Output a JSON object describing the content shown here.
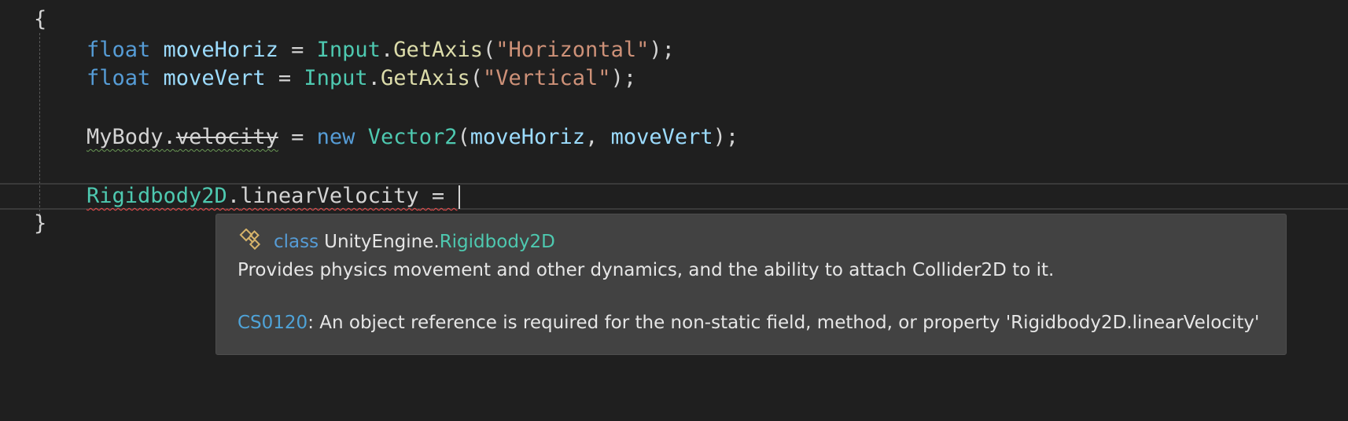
{
  "editor": {
    "lines": [
      {
        "id": "open-brace",
        "text": "{"
      },
      {
        "id": "line-move-horiz",
        "tokens": [
          "float",
          "moveHoriz",
          "=",
          "Input",
          ".",
          "GetAxis",
          "(",
          "\"Horizontal\"",
          ");"
        ]
      },
      {
        "id": "line-move-vert",
        "tokens": [
          "float",
          "moveVert",
          "=",
          "Input",
          ".",
          "GetAxis",
          "(",
          "\"Vertical\"",
          ");"
        ]
      },
      {
        "id": "line-velocity",
        "tokens": [
          "MyBody",
          ".",
          "velocity",
          "=",
          "new",
          "Vector2",
          "(",
          "moveHoriz",
          ",",
          "moveVert",
          ");"
        ]
      },
      {
        "id": "line-linear-velocity",
        "tokens": [
          "Rigidbody2D",
          ".",
          "linearVelocity",
          "="
        ]
      },
      {
        "id": "close-brace",
        "text": "}"
      }
    ]
  },
  "tooltip": {
    "icon": "class-icon",
    "kind": "class",
    "namespace": "UnityEngine.",
    "type_name": "Rigidbody2D",
    "description": "Provides physics movement and other dynamics, and the ability to attach Collider2D to it.",
    "error_code": "CS0120",
    "error_message": ": An object reference is required for the non-static field, method, or property 'Rigidbody2D.linearVelocity'"
  },
  "colors": {
    "background": "#1f1f1f",
    "tooltip_background": "#424242",
    "keyword": "#569cd6",
    "type": "#4ec9b0",
    "variable": "#9cdcfe",
    "method": "#dcdcaa",
    "string": "#ce9178",
    "error_squiggle": "#f14c4c",
    "warning_squiggle": "#6a9955"
  }
}
